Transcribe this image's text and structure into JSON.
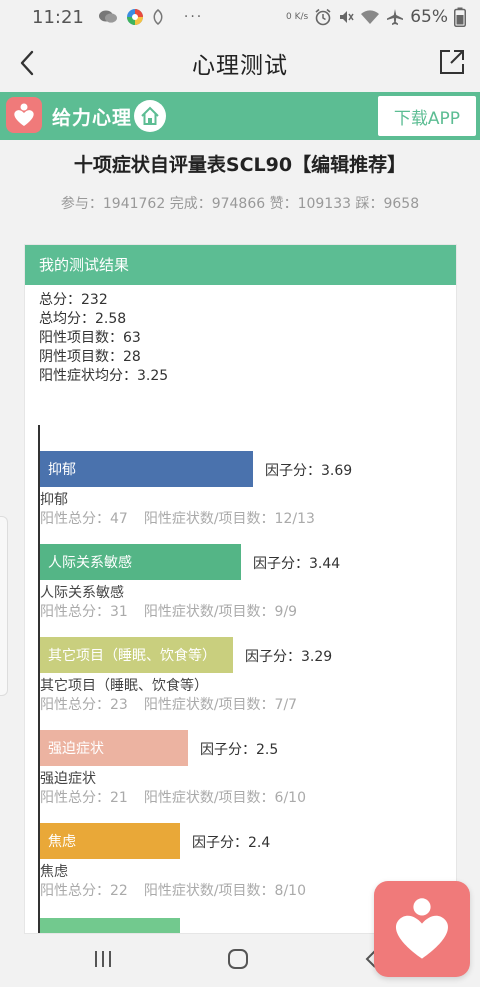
{
  "status": {
    "time": "11:21",
    "battery": "65%",
    "net_speed": "0 K/s"
  },
  "header": {
    "title": "心理测试"
  },
  "brand": {
    "name": "给力心理",
    "download_label": "下载APP"
  },
  "test": {
    "title": "十项症状自评量表SCL90【编辑推荐】",
    "stats": "参与：1941762 完成：974866 赞：109133 踩：9658"
  },
  "result": {
    "header": "我的测试结果",
    "summary": [
      "总分：232",
      "总均分：2.58",
      "阳性项目数：63",
      "阴性项目数：28",
      "阳性症状均分：3.25"
    ]
  },
  "chart_data": {
    "type": "bar",
    "orientation": "horizontal",
    "categories": [
      "抑郁",
      "人际关系敏感",
      "其它项目（睡眠、饮食等）",
      "强迫症状",
      "焦虑"
    ],
    "values": [
      3.69,
      3.44,
      3.29,
      2.5,
      2.4
    ]
  },
  "factors": [
    {
      "name": "抑郁",
      "score_label": "因子分：3.69",
      "positive_total": "阳性总分：47",
      "ratio": "阳性症状数/项目数：12/13",
      "color": "#4a72ad"
    },
    {
      "name": "人际关系敏感",
      "score_label": "因子分：3.44",
      "positive_total": "阳性总分：31",
      "ratio": "阳性症状数/项目数：9/9",
      "color": "#54b586"
    },
    {
      "name": "其它项目（睡眠、饮食等）",
      "score_label": "因子分：3.29",
      "positive_total": "阳性总分：23",
      "ratio": "阳性症状数/项目数：7/7",
      "color": "#c9cf7e"
    },
    {
      "name": "强迫症状",
      "score_label": "因子分：2.5",
      "positive_total": "阳性总分：21",
      "ratio": "阳性症状数/项目数：6/10",
      "color": "#ecb3a1"
    },
    {
      "name": "焦虑",
      "score_label": "因子分：2.4",
      "positive_total": "阳性总分：22",
      "ratio": "阳性症状数/项目数：8/10",
      "color": "#e9a838"
    }
  ],
  "partial_bar_color": "#72c98e"
}
